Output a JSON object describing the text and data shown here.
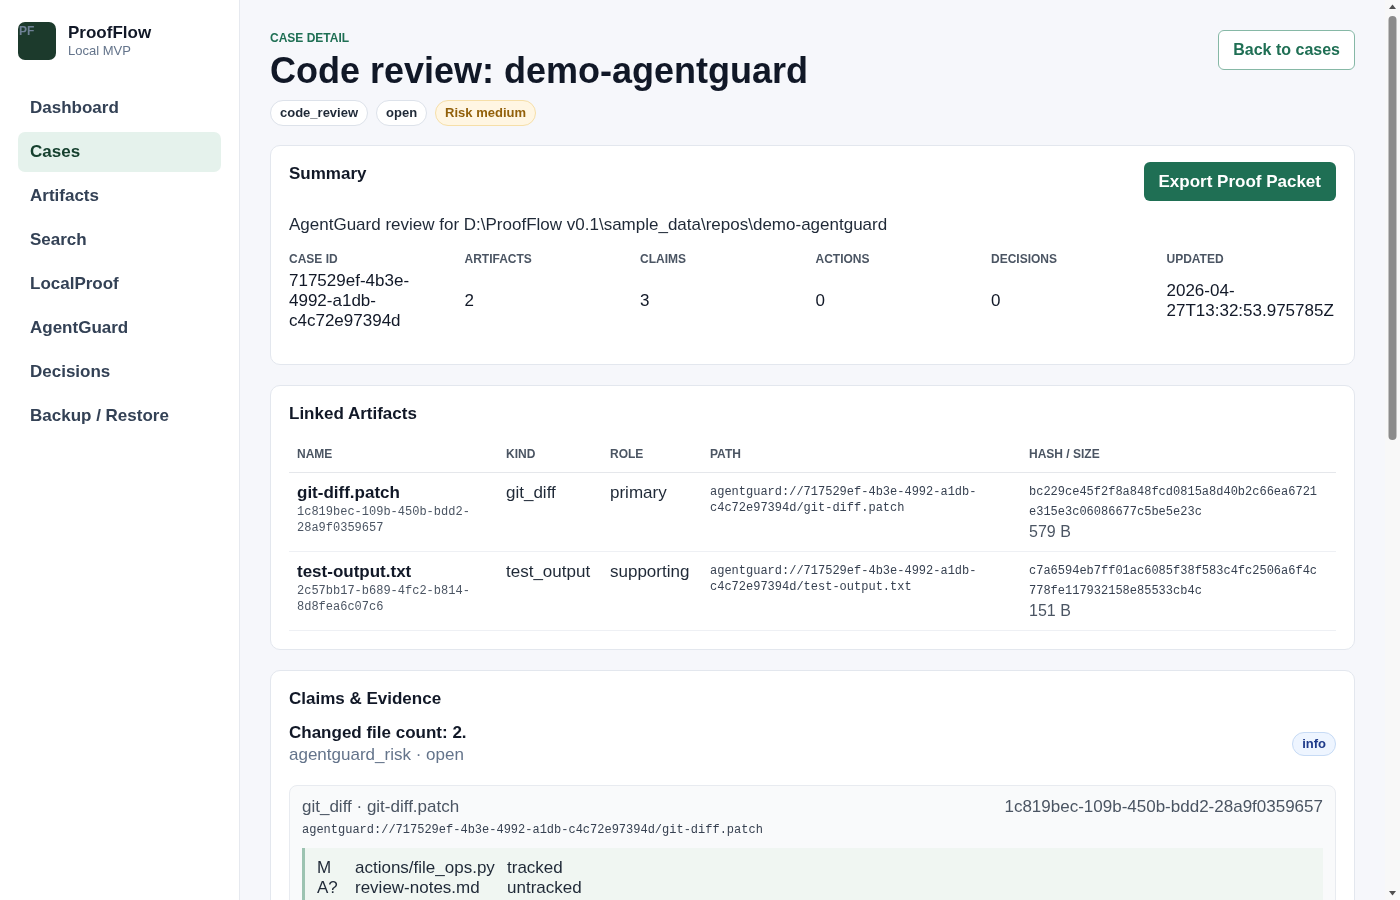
{
  "sidebar": {
    "logo": "PF",
    "brand": "ProofFlow",
    "subtitle": "Local MVP",
    "items": [
      {
        "label": "Dashboard",
        "selected": false
      },
      {
        "label": "Cases",
        "selected": true
      },
      {
        "label": "Artifacts",
        "selected": false
      },
      {
        "label": "Search",
        "selected": false
      },
      {
        "label": "LocalProof",
        "selected": false
      },
      {
        "label": "AgentGuard",
        "selected": false
      },
      {
        "label": "Decisions",
        "selected": false
      },
      {
        "label": "Backup / Restore",
        "selected": false
      }
    ]
  },
  "header": {
    "eyebrow": "CASE DETAIL",
    "title": "Code review: demo-agentguard",
    "tags": [
      {
        "label": "code_review",
        "kind": "neutral"
      },
      {
        "label": "open",
        "kind": "neutral"
      },
      {
        "label": "Risk medium",
        "kind": "warning"
      }
    ],
    "back_button": "Back to cases"
  },
  "summary": {
    "title": "Summary",
    "export_button": "Export Proof Packet",
    "description": "AgentGuard review for D:\\ProofFlow v0.1\\sample_data\\repos\\demo-agentguard",
    "stats": [
      {
        "label": "CASE ID",
        "value": "717529ef-4b3e-4992-a1db-c4c72e97394d"
      },
      {
        "label": "ARTIFACTS",
        "value": "2"
      },
      {
        "label": "CLAIMS",
        "value": "3"
      },
      {
        "label": "ACTIONS",
        "value": "0"
      },
      {
        "label": "DECISIONS",
        "value": "0"
      },
      {
        "label": "UPDATED",
        "value": "2026-04-27T13:32:53.975785Z"
      }
    ]
  },
  "linked_artifacts": {
    "title": "Linked Artifacts",
    "columns": [
      "NAME",
      "KIND",
      "ROLE",
      "PATH",
      "HASH / SIZE"
    ],
    "rows": [
      {
        "name": "git-diff.patch",
        "id": "1c819bec-109b-450b-bdd2-28a9f0359657",
        "kind": "git_diff",
        "role": "primary",
        "path": "agentguard://717529ef-4b3e-4992-a1db-c4c72e97394d/git-diff.patch",
        "hash": "bc229ce45f2f8a848fcd0815a8d40b2c66ea6721e315e3c06086677c5be5e23c",
        "size": "579 B"
      },
      {
        "name": "test-output.txt",
        "id": "2c57bb17-b689-4fc2-b814-8d8fea6c07c6",
        "kind": "test_output",
        "role": "supporting",
        "path": "agentguard://717529ef-4b3e-4992-a1db-c4c72e97394d/test-output.txt",
        "hash": "c7a6594eb7ff01ac6085f38f583c4fc2506a6f4c778fe117932158e85533cb4c",
        "size": "151 B"
      }
    ]
  },
  "claims": {
    "title": "Claims & Evidence",
    "items": [
      {
        "title": "Changed file count: 2.",
        "meta": "agentguard_risk · open",
        "badge": "info",
        "evidence": [
          {
            "source": "git_diff · git-diff.patch",
            "id": "1c819bec-109b-450b-bdd2-28a9f0359657",
            "path": "agentguard://717529ef-4b3e-4992-a1db-c4c72e97394d/git-diff.patch",
            "lines": [
              {
                "status": "M",
                "file": "actions/file_ops.py",
                "tracking": "tracked"
              },
              {
                "status": "A?",
                "file": "review-notes.md",
                "tracking": "untracked"
              }
            ]
          }
        ]
      }
    ]
  }
}
